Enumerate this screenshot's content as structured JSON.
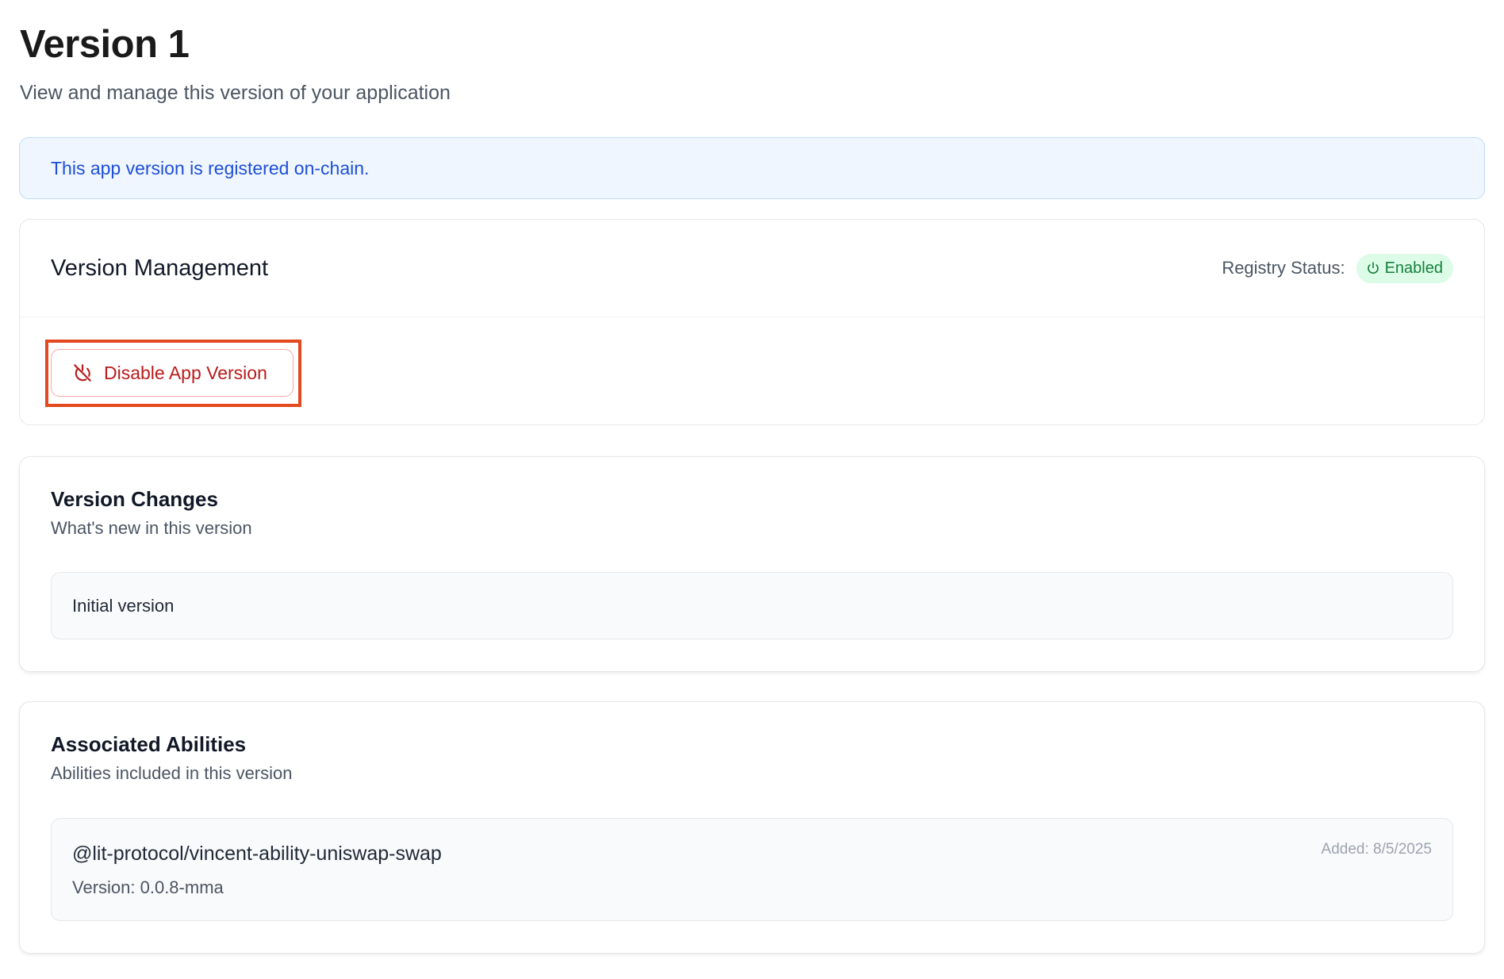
{
  "header": {
    "title": "Version 1",
    "subtitle": "View and manage this version of your application"
  },
  "alert": {
    "text": "This app version is registered on-chain."
  },
  "management": {
    "title": "Version Management",
    "status_label": "Registry Status:",
    "status_badge": "Enabled",
    "status_icon": "power-icon",
    "disable_button": "Disable App Version",
    "disable_icon": "power-off-icon"
  },
  "changes": {
    "title": "Version Changes",
    "subtitle": "What's new in this version",
    "text": "Initial version"
  },
  "abilities": {
    "title": "Associated Abilities",
    "subtitle": "Abilities included in this version",
    "items": [
      {
        "name": "@lit-protocol/vincent-ability-uniswap-swap",
        "version": "Version: 0.0.8-mma",
        "added": "Added: 8/5/2025"
      }
    ]
  },
  "colors": {
    "accent_blue": "#1d4ed8",
    "success_green": "#15803d",
    "danger_red": "#b91c1c",
    "highlight": "#e2491f"
  }
}
